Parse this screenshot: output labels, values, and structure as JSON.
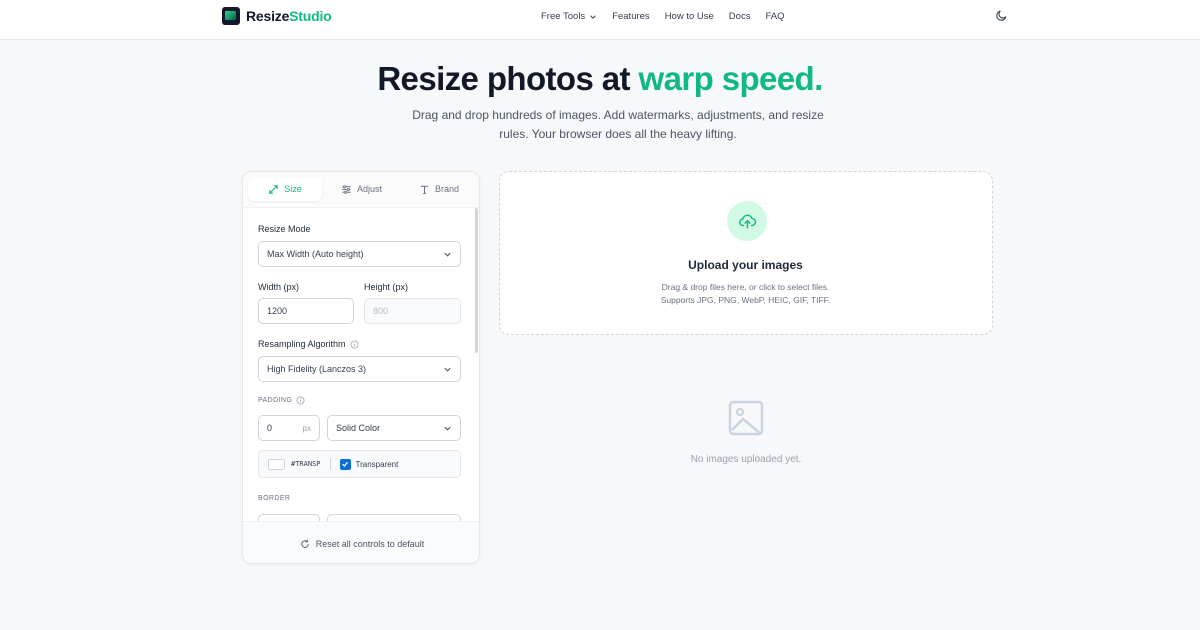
{
  "brand": {
    "name_part1": "Resize",
    "name_part2": "Studio"
  },
  "nav": {
    "items": [
      "Free Tools",
      "Features",
      "How to Use",
      "Docs",
      "FAQ"
    ]
  },
  "icons": {
    "theme_toggle": "moon-icon",
    "free_tools_chevron": "chevron-down-icon"
  },
  "hero": {
    "title_main": "Resize photos at ",
    "title_accent": "warp speed.",
    "subtitle_line1": "Drag and drop hundreds of images. Add watermarks, adjustments, and resize",
    "subtitle_line2": "rules. Your browser does all the heavy lifting."
  },
  "panel": {
    "tabs": [
      {
        "label": "Size",
        "icon": "resize-arrows-icon",
        "active": true
      },
      {
        "label": "Adjust",
        "icon": "sliders-icon",
        "active": false
      },
      {
        "label": "Brand",
        "icon": "text-type-icon",
        "active": false
      }
    ],
    "resize_mode": {
      "label": "Resize Mode",
      "value": "Max Width (Auto height)"
    },
    "width": {
      "label": "Width (px)",
      "value": "1200"
    },
    "height": {
      "label": "Height (px)",
      "placeholder": "800"
    },
    "resampling": {
      "label": "Resampling Algorithm",
      "value": "High Fidelity (Lanczos 3)"
    },
    "padding": {
      "label": "PADDING",
      "value": "0",
      "unit": "px",
      "fill": "Solid Color",
      "color_hex": "#TRANSP",
      "transparent_label": "Transparent",
      "transparent_checked": true
    },
    "border": {
      "label": "BORDER"
    },
    "reset_label": "Reset all controls to default"
  },
  "upload": {
    "title": "Upload your images",
    "line1": "Drag & drop files here, or click to select files.",
    "line2": "Supports JPG, PNG, WebP, HEIC, GIF, TIFF."
  },
  "empty_state": {
    "text": "No images uploaded yet."
  },
  "colors": {
    "accent": "#10b981",
    "accent_light": "#d1fae5",
    "checkbox": "#0b6fd6",
    "background": "#f6f8fa"
  }
}
